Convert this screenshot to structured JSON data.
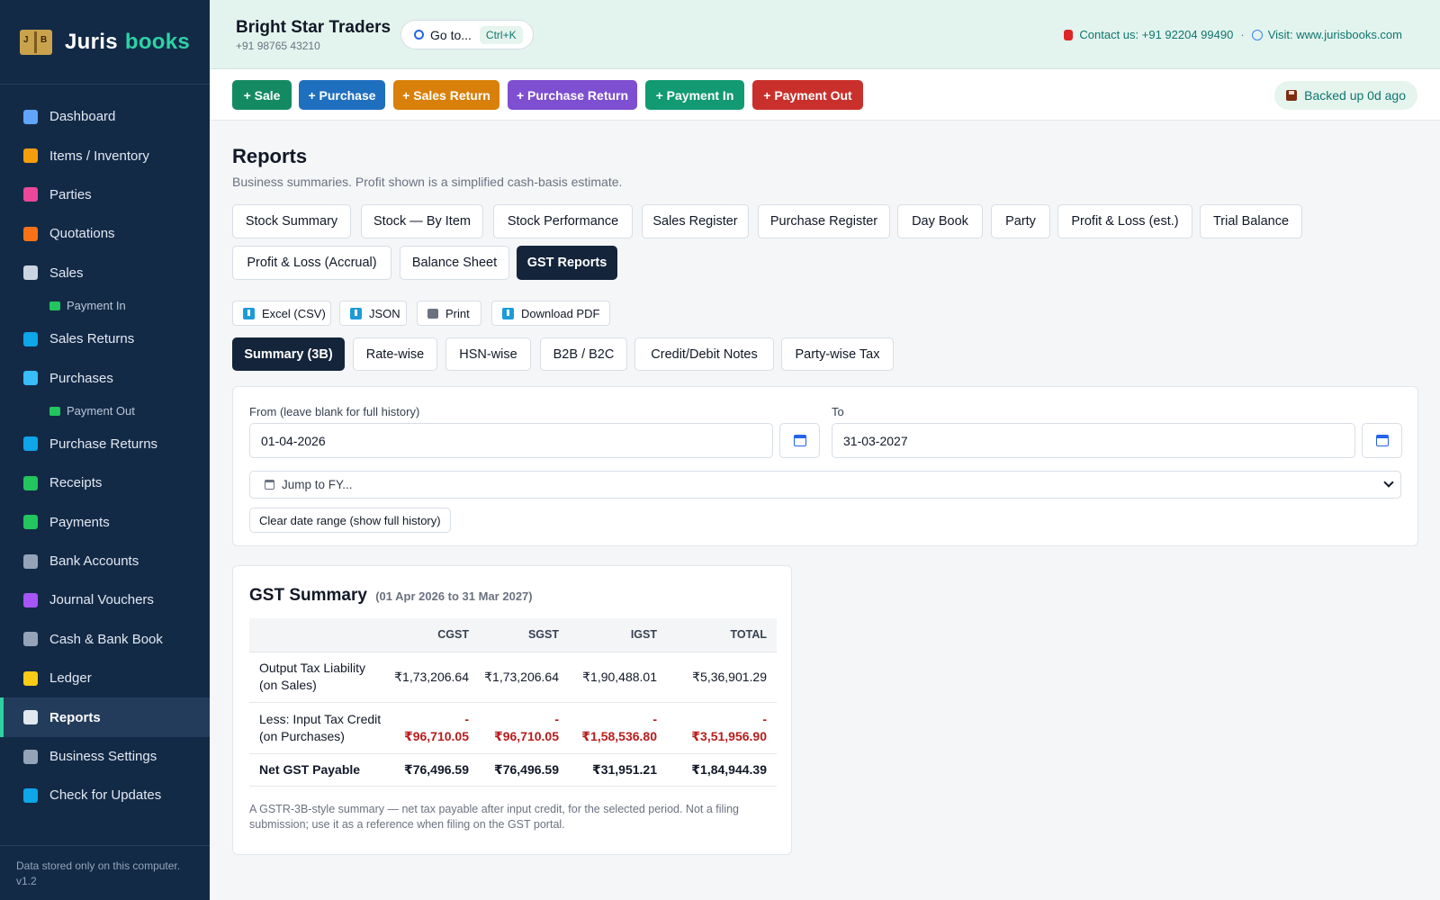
{
  "brand": {
    "name": "Juris",
    "accent": "books",
    "logo_left": "J",
    "logo_right": "B"
  },
  "sidebar": {
    "items": [
      {
        "label": "Dashboard",
        "icon": "bar-chart-icon",
        "color": "#60a5fa"
      },
      {
        "label": "Items / Inventory",
        "icon": "box-icon",
        "color": "#f59e0b"
      },
      {
        "label": "Parties",
        "icon": "people-icon",
        "color": "#ec4899"
      },
      {
        "label": "Quotations",
        "icon": "memo-icon",
        "color": "#f97316"
      },
      {
        "label": "Sales",
        "icon": "receipt-icon",
        "color": "#cbd5e1"
      },
      {
        "label": "Sales Returns",
        "icon": "return-arrow-icon",
        "color": "#0ea5e9"
      },
      {
        "label": "Purchases",
        "icon": "cart-icon",
        "color": "#38bdf8"
      },
      {
        "label": "Purchase Returns",
        "icon": "return-arrow-icon",
        "color": "#0ea5e9"
      },
      {
        "label": "Receipts",
        "icon": "cash-icon",
        "color": "#22c55e"
      },
      {
        "label": "Payments",
        "icon": "money-wings-icon",
        "color": "#22c55e"
      },
      {
        "label": "Bank Accounts",
        "icon": "bank-icon",
        "color": "#94a3b8"
      },
      {
        "label": "Journal Vouchers",
        "icon": "notebook-icon",
        "color": "#a855f7"
      },
      {
        "label": "Cash & Bank Book",
        "icon": "bank-book-icon",
        "color": "#94a3b8"
      },
      {
        "label": "Ledger",
        "icon": "ledger-icon",
        "color": "#facc15"
      },
      {
        "label": "Reports",
        "icon": "chart-icon",
        "color": "#e2e8f0"
      },
      {
        "label": "Business Settings",
        "icon": "gear-icon",
        "color": "#94a3b8"
      },
      {
        "label": "Check for Updates",
        "icon": "refresh-icon",
        "color": "#0ea5e9"
      }
    ],
    "sub_sales": "Payment In",
    "sub_purchases": "Payment Out",
    "footer_line1": "Data stored only on this computer.",
    "footer_line2": "v1.2"
  },
  "header": {
    "business_name": "Bright Star Traders",
    "business_phone": "+91 98765 43210",
    "goto_label": "Go to...",
    "goto_shortcut": "Ctrl+K",
    "contact": "Contact us: +91 92204 99490",
    "separator": "·",
    "visit": "Visit: www.jurisbooks.com"
  },
  "actions": [
    {
      "label": "+ Sale",
      "color": "#148a63"
    },
    {
      "label": "+ Purchase",
      "color": "#1f6fbf"
    },
    {
      "label": "+ Sales Return",
      "color": "#d9800a"
    },
    {
      "label": "+ Purchase Return",
      "color": "#7e4fd0"
    },
    {
      "label": "+ Payment In",
      "color": "#129a72"
    },
    {
      "label": "+ Payment Out",
      "color": "#c9302c"
    }
  ],
  "backup_status": "Backed up 0d ago",
  "reports": {
    "title": "Reports",
    "subtitle": "Business summaries. Profit shown is a simplified cash-basis estimate.",
    "tabs": [
      "Stock Summary",
      "Stock — By Item",
      "Stock Performance",
      "Sales Register",
      "Purchase Register",
      "Day Book",
      "Party",
      "Profit & Loss (est.)",
      "Trial Balance",
      "Profit & Loss (Accrual)",
      "Balance Sheet",
      "GST Reports"
    ],
    "active_tab": "GST Reports",
    "exports": [
      "Excel (CSV)",
      "JSON",
      "Print",
      "Download PDF"
    ],
    "subtabs": [
      "Summary (3B)",
      "Rate-wise",
      "HSN-wise",
      "B2B / B2C",
      "Credit/Debit Notes",
      "Party-wise Tax"
    ],
    "active_subtab": "Summary (3B)"
  },
  "filter": {
    "from_label": "From (leave blank for full history)",
    "from_value": "01-04-2026",
    "to_label": "To",
    "to_value": "31-03-2027",
    "fy_select": "Jump to FY...",
    "clear_label": "Clear date range (show full history)"
  },
  "gst_summary": {
    "title": "GST Summary",
    "period": "(01 Apr 2026 to 31 Mar 2027)",
    "columns": [
      "",
      "CGST",
      "SGST",
      "IGST",
      "TOTAL"
    ],
    "rows": [
      {
        "label_1": "Output Tax Liability",
        "label_2": "(on Sales)",
        "cgst": "₹1,73,206.64",
        "sgst": "₹1,73,206.64",
        "igst": "₹1,90,488.01",
        "total": "₹5,36,901.29"
      },
      {
        "label_1": "Less: Input Tax Credit",
        "label_2": "(on Purchases)",
        "cgst": "₹96,710.05",
        "sgst": "₹96,710.05",
        "igst": "₹1,58,536.80",
        "total": "₹3,51,956.90",
        "sign": "-"
      },
      {
        "label_1": "Net GST Payable",
        "cgst": "₹76,496.59",
        "sgst": "₹76,496.59",
        "igst": "₹31,951.21",
        "total": "₹1,84,944.39"
      }
    ],
    "note": "A GSTR-3B-style summary — net tax payable after input credit, for the selected period. Not a filing submission; use it as a reference when filing on the GST portal."
  }
}
